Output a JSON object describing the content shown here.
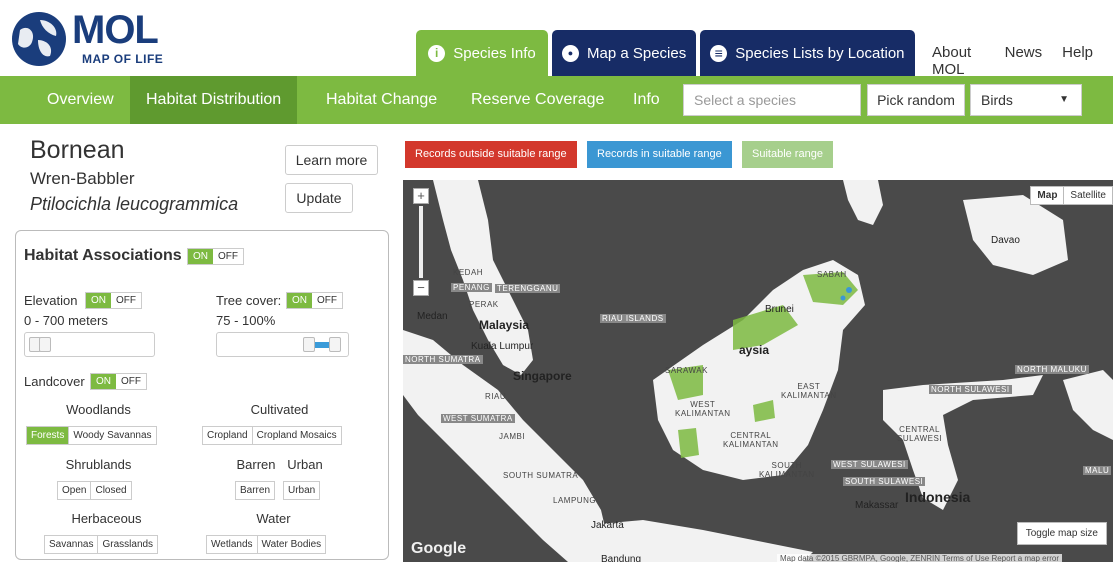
{
  "logo": {
    "title": "MOL",
    "subtitle": "MAP OF LIFE"
  },
  "top_tabs": [
    {
      "label": "Species Info",
      "icon": "info-icon"
    },
    {
      "label": "Map a Species",
      "icon": "map-pin-icon"
    },
    {
      "label": "Species Lists by Location",
      "icon": "list-icon"
    }
  ],
  "top_links": [
    "About MOL",
    "News",
    "Help"
  ],
  "nav": {
    "items": [
      "Overview",
      "Habitat Distribution",
      "Habitat Change",
      "Reserve Coverage",
      "Info"
    ],
    "active": "Habitat Distribution",
    "search_placeholder": "Select a species",
    "pick_random": "Pick random",
    "group_selected": "Birds"
  },
  "species": {
    "common_line1": "Bornean",
    "common_line2": "Wren-Babbler",
    "scientific": "Ptilocichla leucogrammica",
    "learn_more": "Learn more",
    "update": "Update"
  },
  "habitat": {
    "title": "Habitat Associations",
    "on": "ON",
    "off": "OFF",
    "elevation_label": "Elevation",
    "elevation_value": "0 - 700 meters",
    "tree_cover_label": "Tree cover:",
    "tree_cover_value": "75 - 100%",
    "landcover_label": "Landcover",
    "categories": [
      {
        "name": "Woodlands",
        "options": [
          "Forests",
          "Woody Savannas"
        ],
        "selected": [
          "Forests"
        ]
      },
      {
        "name": "Cultivated",
        "options": [
          "Cropland",
          "Cropland Mosaics"
        ],
        "selected": []
      },
      {
        "name": "Shrublands",
        "options": [
          "Open",
          "Closed"
        ],
        "selected": []
      },
      {
        "name": "Barren",
        "options": [
          "Barren"
        ],
        "selected": []
      },
      {
        "name": "Urban",
        "options": [
          "Urban"
        ],
        "selected": []
      },
      {
        "name": "Herbaceous",
        "options": [
          "Savannas",
          "Grasslands"
        ],
        "selected": []
      },
      {
        "name": "Water",
        "options": [
          "Wetlands",
          "Water Bodies"
        ],
        "selected": []
      }
    ]
  },
  "legend": {
    "outside": "Records outside suitable range",
    "inside": "Records in suitable range",
    "suitable": "Suitable range"
  },
  "map": {
    "type_map": "Map",
    "type_satellite": "Satellite",
    "toggle_size": "Toggle map size",
    "google": "Google",
    "attribution": "Map data ©2015 GBRMPA, Google, ZENRIN    Terms of Use    Report a map error",
    "places": {
      "davao": "Davao",
      "kedah": "KEDAH",
      "penang": "PENANG",
      "terengganu": "TERENGGANU",
      "perak": "PERAK",
      "medan": "Medan",
      "malaysia": "Malaysia",
      "kuala_lumpur": "Kuala Lumpur",
      "riau_islands": "RIAU ISLANDS",
      "north_sumatra": "NORTH SUMATRA",
      "singapore": "Singapore",
      "riau": "RIAU",
      "west_sumatra": "WEST SUMATRA",
      "jambi": "JAMBI",
      "south_sumatra": "SOUTH SUMATRA",
      "lampung": "LAMPUNG",
      "jakarta": "Jakarta",
      "bandung": "Bandung",
      "sabah": "SABAH",
      "brunei": "Brunei",
      "malaysia_borneo": "aysia",
      "sarawak": "SARAWAK",
      "west_kalimantan": "WEST\nKALIMANTAN",
      "central_kalimantan": "CENTRAL\nKALIMANTAN",
      "east_kalimantan": "EAST\nKALIMANTAN",
      "south_kalimantan": "SOUTH\nKALIMANTAN",
      "north_sulawesi": "NORTH SULAWESI",
      "north_maluku": "NORTH MALUKU",
      "central_sulawesi": "CENTRAL\nSULAWESI",
      "west_sulawesi": "WEST SULAWESI",
      "south_sulawesi": "SOUTH SULAWESI",
      "indonesia": "Indonesia",
      "makassar": "Makassar",
      "malu": "MALU"
    }
  },
  "colors": {
    "brand_green": "#7dba41",
    "brand_navy": "#172c66",
    "active_nav": "#5f9a2f",
    "record_outside": "#d3382c",
    "record_inside": "#3b97d3",
    "suitable_range": "#a6cf8c"
  }
}
